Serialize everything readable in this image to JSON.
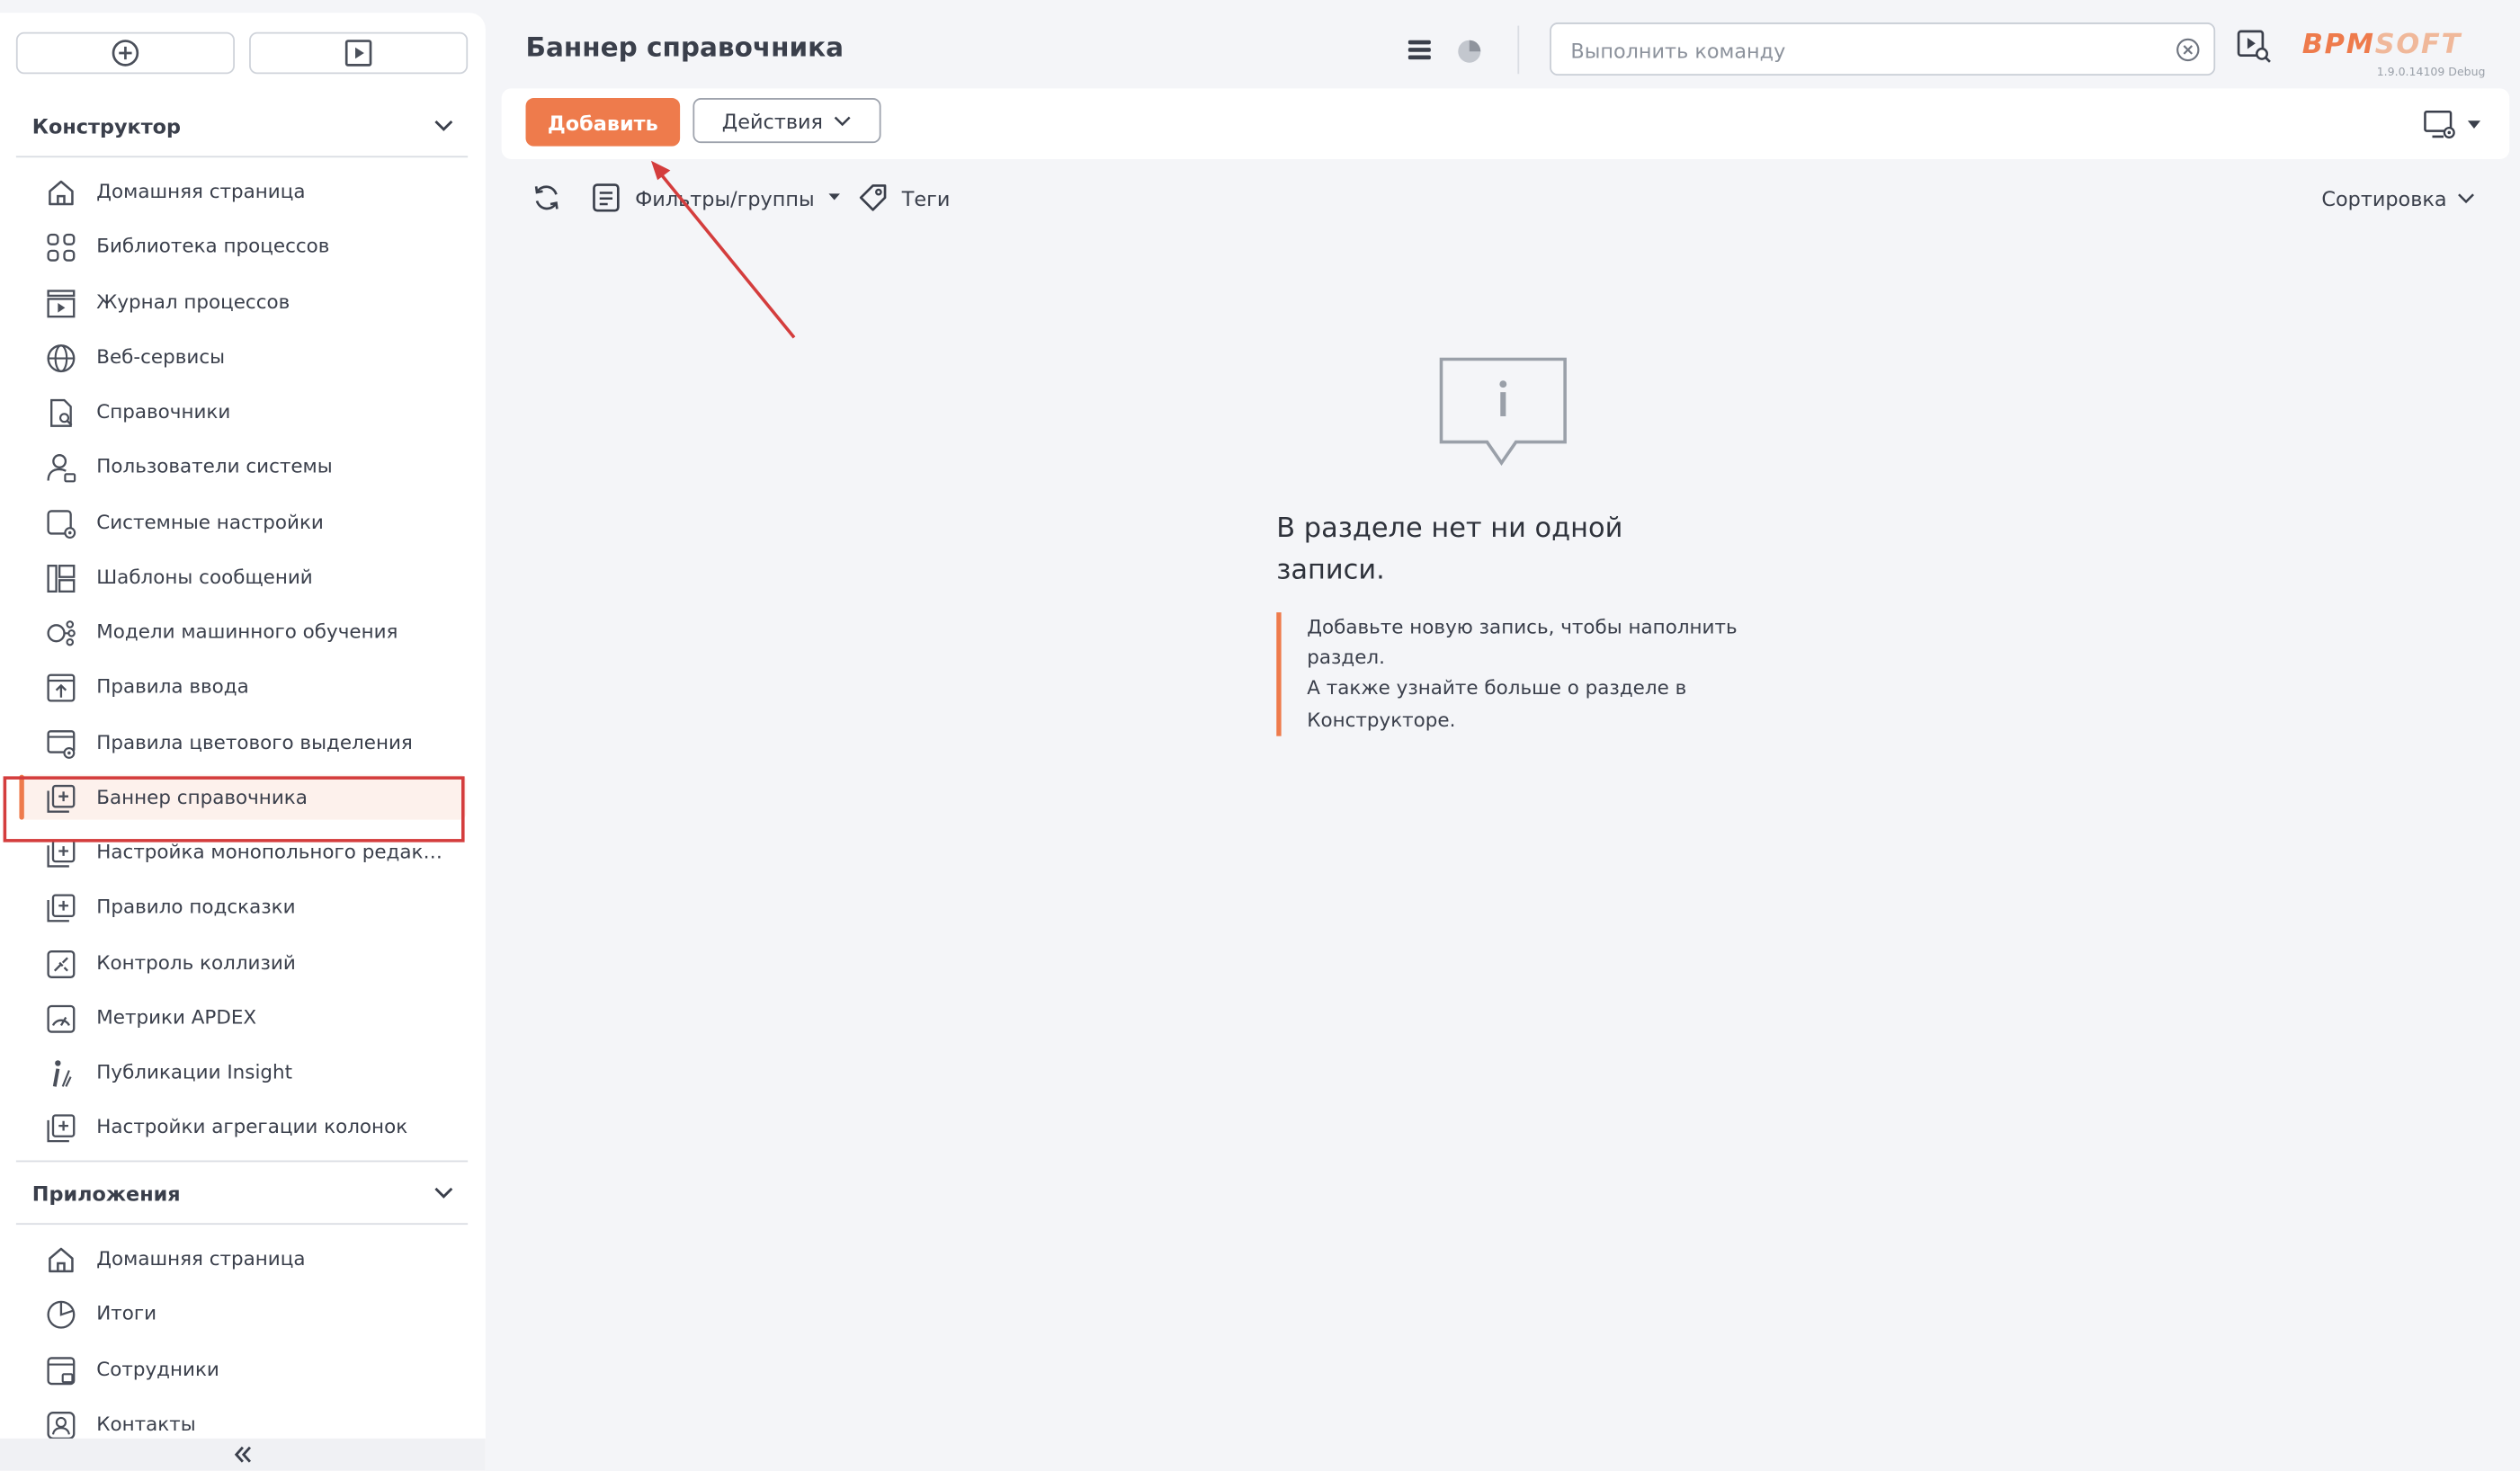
{
  "page": {
    "title": "Баннер справочника",
    "command_placeholder": "Выполнить команду",
    "logo_bpm": "BPM",
    "logo_soft": "SOFT",
    "version": "1.9.0.14109 Debug"
  },
  "toolbar": {
    "add_label": "Добавить",
    "actions_label": "Действия"
  },
  "filters": {
    "filters_label": "Фильтры/группы",
    "tags_label": "Теги",
    "sort_label": "Сортировка"
  },
  "sidebar": {
    "designer": {
      "title": "Конструктор",
      "items": [
        {
          "label": "Домашняя страница",
          "icon": "home-icon"
        },
        {
          "label": "Библиотека процессов",
          "icon": "process-library-icon"
        },
        {
          "label": "Журнал процессов",
          "icon": "process-log-icon"
        },
        {
          "label": "Веб-сервисы",
          "icon": "globe-icon"
        },
        {
          "label": "Справочники",
          "icon": "lookup-icon"
        },
        {
          "label": "Пользователи системы",
          "icon": "user-lock-icon"
        },
        {
          "label": "Системные настройки",
          "icon": "settings-square-icon"
        },
        {
          "label": "Шаблоны сообщений",
          "icon": "template-icon"
        },
        {
          "label": "Модели машинного обучения",
          "icon": "ml-model-icon"
        },
        {
          "label": "Правила ввода",
          "icon": "input-rules-icon"
        },
        {
          "label": "Правила цветового выделения",
          "icon": "color-rules-icon"
        },
        {
          "label": "Баннер справочника",
          "icon": "banner-icon"
        },
        {
          "label": "Настройка монопольного редактирования",
          "icon": "exclusive-edit-icon"
        },
        {
          "label": "Правило подсказки",
          "icon": "hint-rule-icon"
        },
        {
          "label": "Контроль коллизий",
          "icon": "collision-icon"
        },
        {
          "label": "Метрики APDEX",
          "icon": "gauge-icon"
        },
        {
          "label": "Публикации Insight",
          "icon": "insight-icon"
        },
        {
          "label": "Настройки агрегации колонок",
          "icon": "aggregation-icon"
        }
      ]
    },
    "apps": {
      "title": "Приложения",
      "items": [
        {
          "label": "Домашняя страница",
          "icon": "home-icon"
        },
        {
          "label": "Итоги",
          "icon": "pie-chart-icon"
        },
        {
          "label": "Сотрудники",
          "icon": "employees-icon"
        },
        {
          "label": "Контакты",
          "icon": "contacts-icon"
        }
      ]
    }
  },
  "empty_state": {
    "title": "В разделе нет ни одной записи.",
    "line1": "Добавьте новую запись, чтобы наполнить раздел.",
    "line2": "А также узнайте больше о разделе в Конструкторе."
  },
  "colors": {
    "accent": "#ee7b4c",
    "highlight": "#d43d3d"
  }
}
